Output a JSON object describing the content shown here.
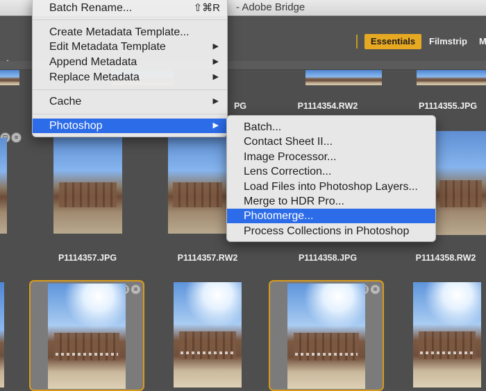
{
  "app": {
    "title": "- Adobe Bridge"
  },
  "workspaces": {
    "essentials": "Essentials",
    "filmstrip": "Filmstrip",
    "more": "M"
  },
  "nav": {
    "forward": "›"
  },
  "main_menu": {
    "items": [
      {
        "label": "Batch Rename...",
        "shortcut": "⇧⌘R"
      },
      {
        "label": "Create Metadata Template..."
      },
      {
        "label": "Edit Metadata Template",
        "submenu_arrow": "▶"
      },
      {
        "label": "Append Metadata",
        "submenu_arrow": "▶"
      },
      {
        "label": "Replace Metadata",
        "submenu_arrow": "▶"
      },
      {
        "label": "Cache",
        "submenu_arrow": "▶"
      },
      {
        "label": "Photoshop",
        "submenu_arrow": "▶",
        "highlighted": true
      }
    ]
  },
  "photoshop_submenu": {
    "items": [
      {
        "label": "Batch..."
      },
      {
        "label": "Contact Sheet II..."
      },
      {
        "label": "Image Processor..."
      },
      {
        "label": "Lens Correction..."
      },
      {
        "label": "Load Files into Photoshop Layers..."
      },
      {
        "label": "Merge to HDR Pro..."
      },
      {
        "label": "Photomerge...",
        "highlighted": true
      },
      {
        "label": "Process Collections in Photoshop"
      }
    ]
  },
  "thumbnails": {
    "row1_labels": [
      "PG",
      "P1114354.RW2",
      "P1114355.JPG"
    ],
    "row2_labels": [
      "P1114357.JPG",
      "P1114357.RW2",
      "P1114358.JPG",
      "P1114358.RW2"
    ]
  },
  "colors": {
    "accent": "#e8a922",
    "menu_highlight": "#2d6ce8",
    "selection_border": "#d99a1b"
  }
}
